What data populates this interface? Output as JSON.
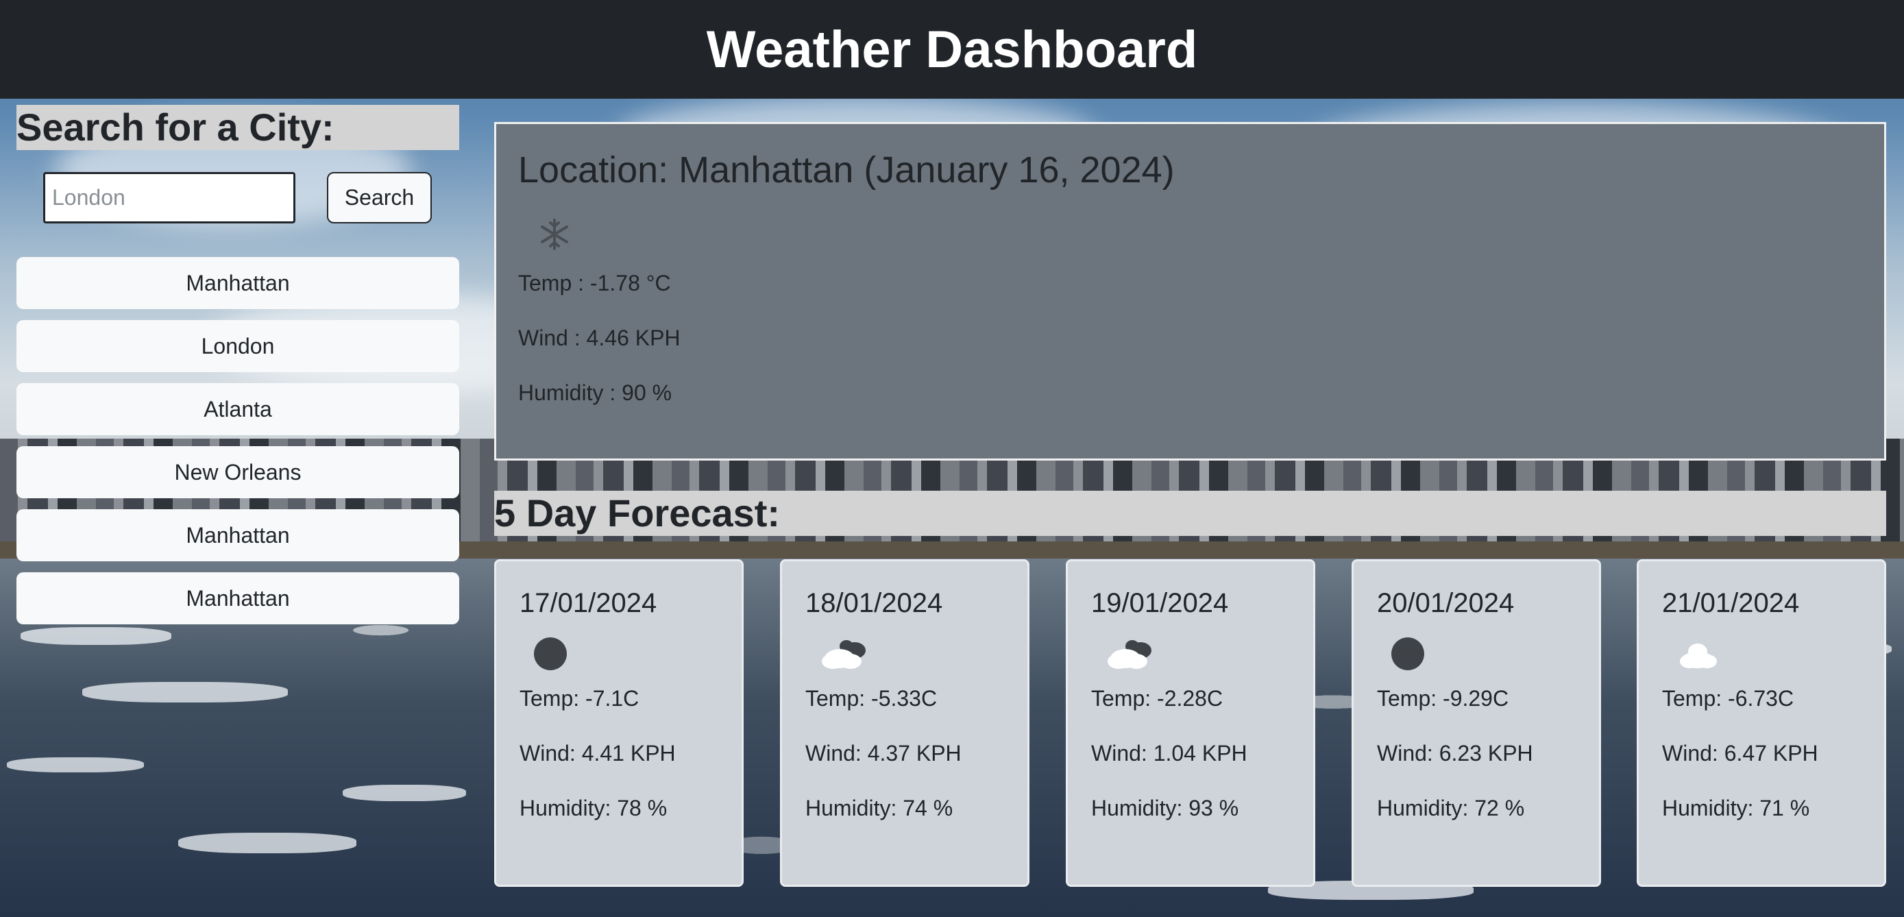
{
  "header": {
    "title": "Weather Dashboard"
  },
  "sidebar": {
    "search_title": "Search for a City:",
    "search_placeholder": "London",
    "search_value": "",
    "search_button": "Search",
    "history": [
      "Manhattan",
      "London",
      "Atlanta",
      "New Orleans",
      "Manhattan",
      "Manhattan"
    ]
  },
  "current": {
    "title": "Location: Manhattan (January 16, 2024)",
    "icon": "snow-icon",
    "temp": "Temp : -1.78 °C",
    "wind": "Wind : 4.46 KPH",
    "humidity": "Humidity : 90 %"
  },
  "forecast": {
    "title": "5 Day Forecast:",
    "days": [
      {
        "date": "17/01/2024",
        "icon": "clear-night-icon",
        "temp": "Temp: -7.1C",
        "wind": "Wind: 4.41 KPH",
        "humidity": "Humidity: 78 %"
      },
      {
        "date": "18/01/2024",
        "icon": "broken-clouds-icon",
        "temp": "Temp: -5.33C",
        "wind": "Wind: 4.37 KPH",
        "humidity": "Humidity: 74 %"
      },
      {
        "date": "19/01/2024",
        "icon": "broken-clouds-icon",
        "temp": "Temp: -2.28C",
        "wind": "Wind: 1.04 KPH",
        "humidity": "Humidity: 93 %"
      },
      {
        "date": "20/01/2024",
        "icon": "clear-night-icon",
        "temp": "Temp: -9.29C",
        "wind": "Wind: 6.23 KPH",
        "humidity": "Humidity: 72 %"
      },
      {
        "date": "21/01/2024",
        "icon": "cloud-icon",
        "temp": "Temp: -6.73C",
        "wind": "Wind: 6.47 KPH",
        "humidity": "Humidity: 71 %"
      }
    ]
  },
  "colors": {
    "header_bg": "#212529",
    "panel_bg": "#6c757d",
    "card_bg": "#cfd4da",
    "title_band": "#d3d3d3",
    "button_bg": "#f8f9fa"
  }
}
